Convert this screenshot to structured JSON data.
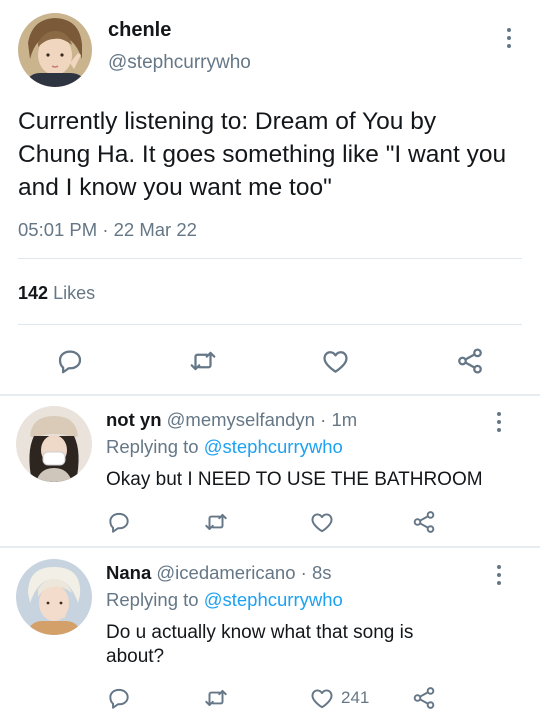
{
  "main_tweet": {
    "display_name": "chenle",
    "handle": "@stephcurrywho",
    "text": "Currently listening to: Dream of You by Chung Ha. It goes something like \"I want you and I know you want me too\"",
    "time": "05:01 PM",
    "date_separator": "·",
    "date": "22 Mar 22",
    "likes_count": "142",
    "likes_label": "Likes",
    "icons": [
      "reply-icon",
      "retweet-icon",
      "like-icon",
      "share-icon"
    ]
  },
  "replies": [
    {
      "display_name": "not yn",
      "handle": "@memyselfandyn",
      "separator": "·",
      "time": "1m",
      "replying_to_label": "Replying to",
      "replying_to_handle": "@stephcurrywho",
      "text": "Okay but I NEED TO USE THE BATHROOM",
      "like_count": ""
    },
    {
      "display_name": "Nana",
      "handle": "@icedamericano",
      "separator": "·",
      "time": "8s",
      "replying_to_label": "Replying to",
      "replying_to_handle": "@stephcurrywho",
      "text": "Do u actually know what that song is about?",
      "like_count": "241"
    }
  ],
  "colors": {
    "text": "#14171a",
    "muted": "#657786",
    "link": "#1da1f2",
    "divider": "#e1e8ed"
  }
}
